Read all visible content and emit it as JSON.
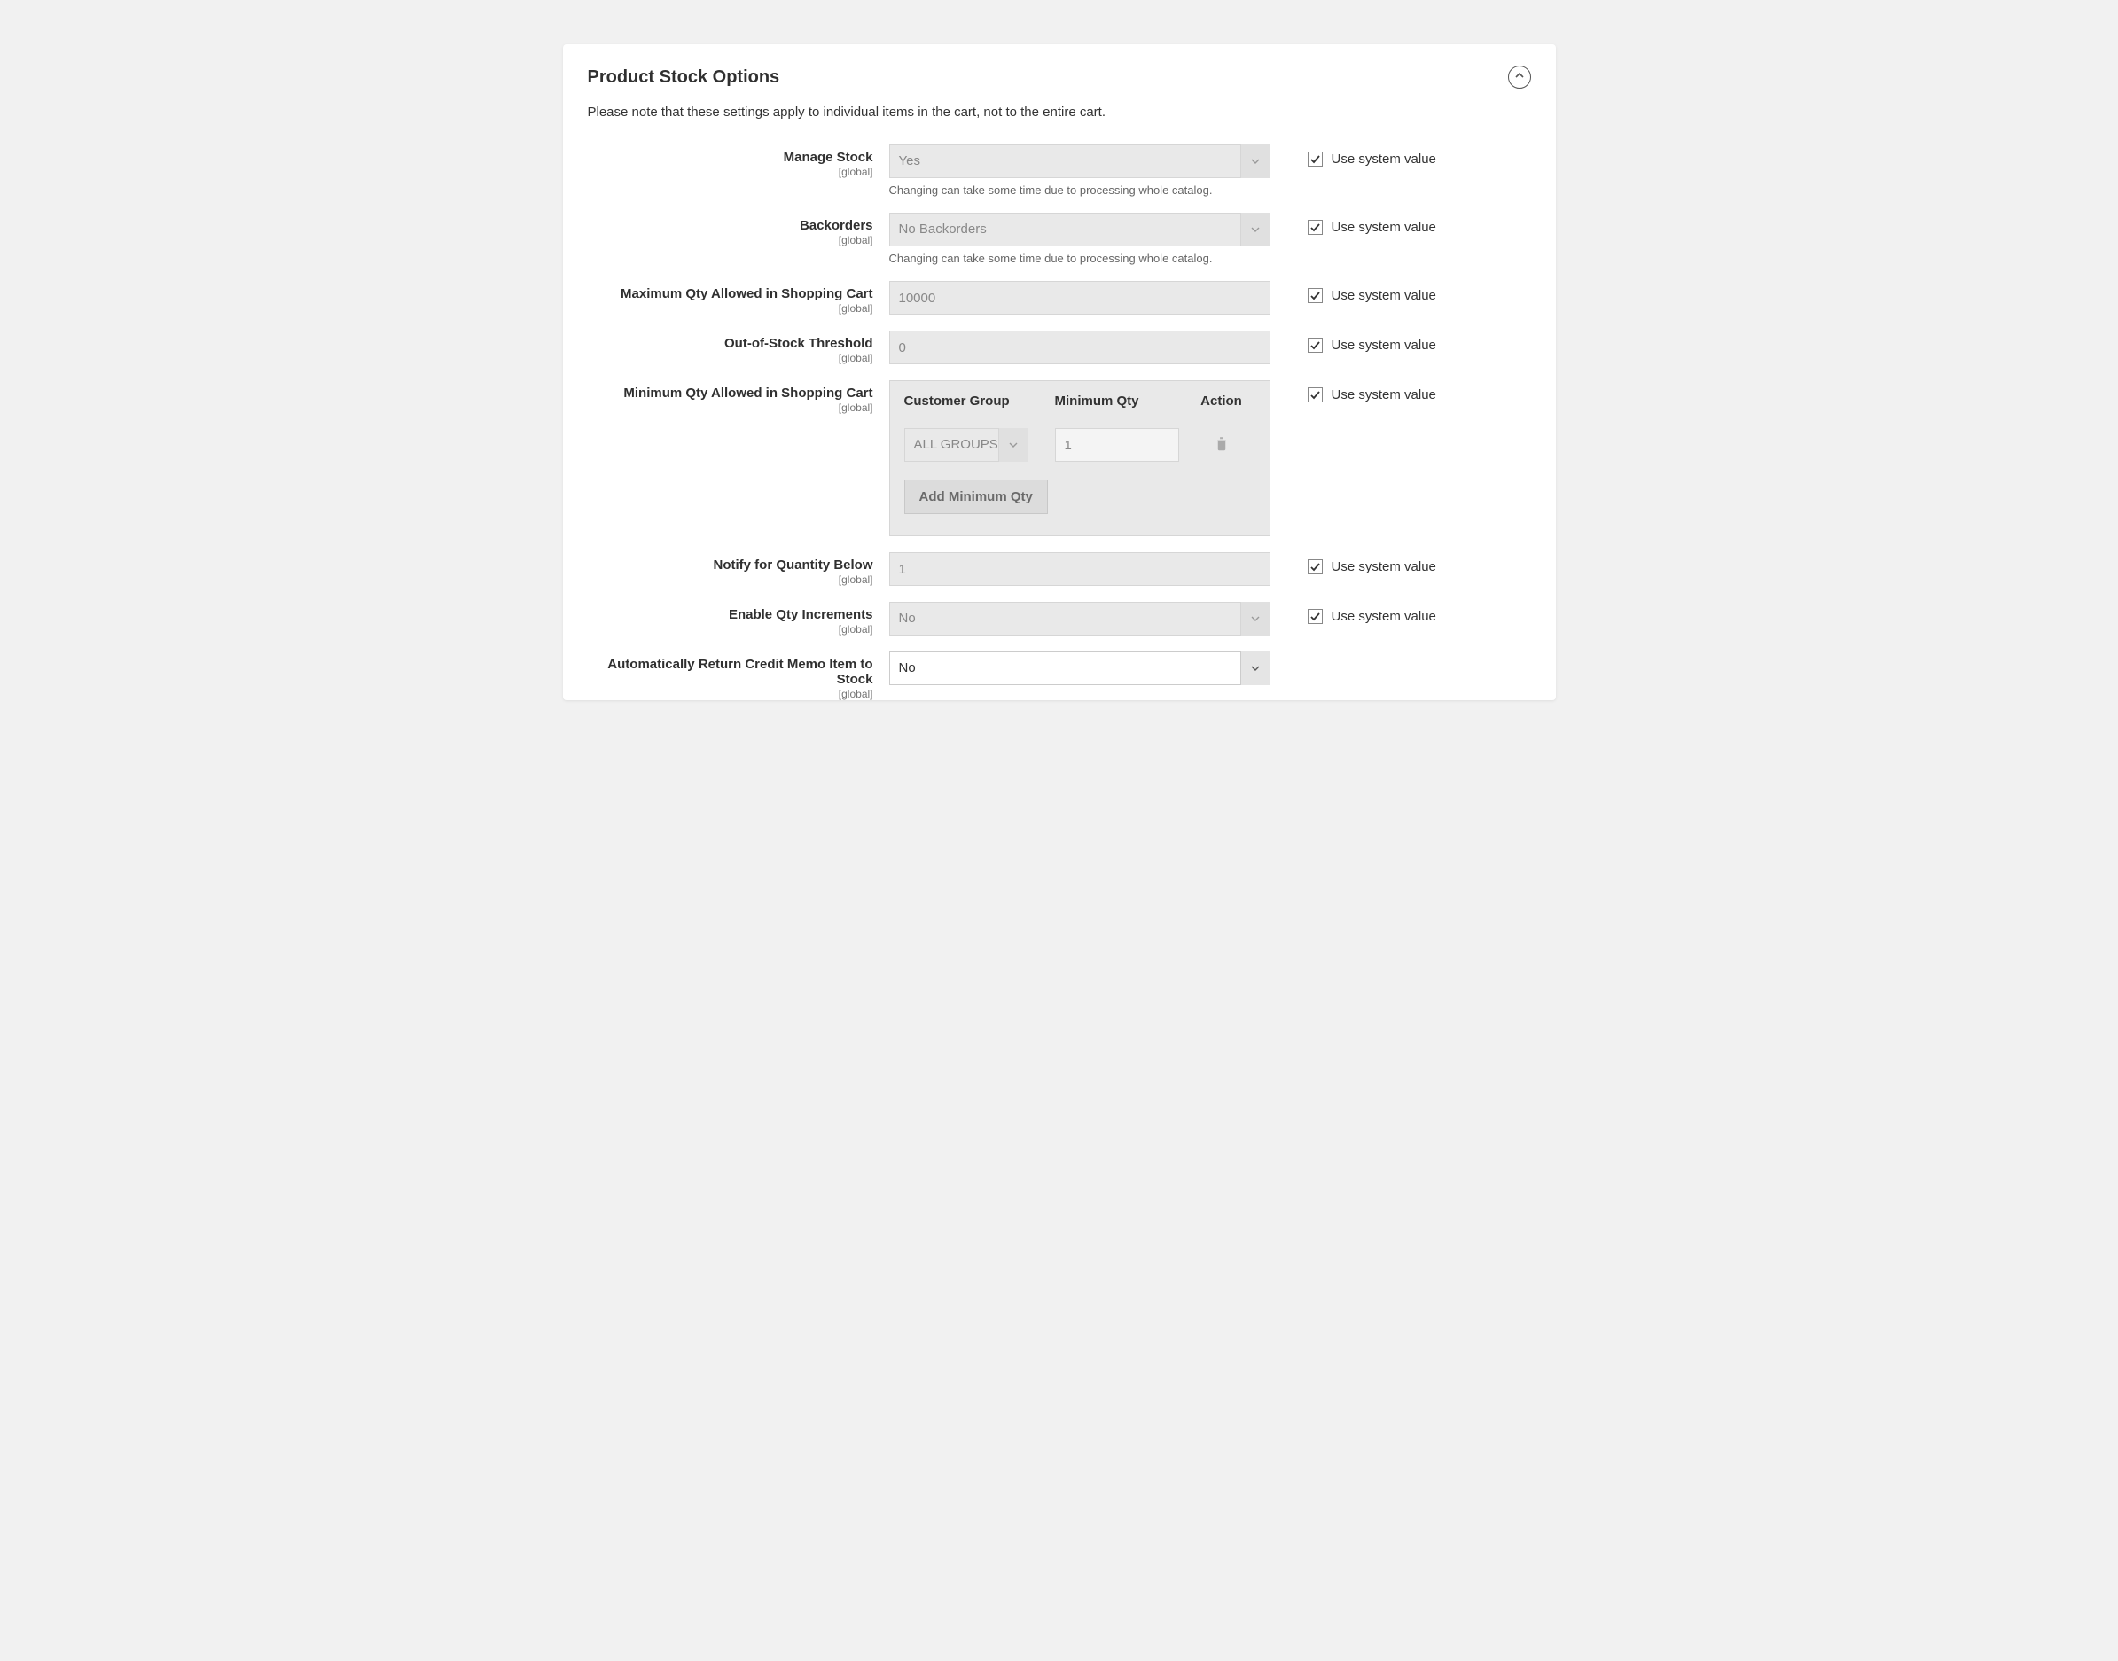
{
  "panel": {
    "title": "Product Stock Options",
    "note": "Please note that these settings apply to individual items in the cart, not to the entire cart."
  },
  "common": {
    "scope_global": "[global]",
    "use_system_value": "Use system value",
    "catalog_note": "Changing can take some time due to processing whole catalog."
  },
  "fields": {
    "manage_stock": {
      "label": "Manage Stock",
      "value": "Yes",
      "use_system": true
    },
    "backorders": {
      "label": "Backorders",
      "value": "No Backorders",
      "use_system": true
    },
    "max_qty": {
      "label": "Maximum Qty Allowed in Shopping Cart",
      "value": "10000",
      "use_system": true
    },
    "oos_threshold": {
      "label": "Out-of-Stock Threshold",
      "value": "0",
      "use_system": true
    },
    "min_qty": {
      "label": "Minimum Qty Allowed in Shopping Cart",
      "use_system": true,
      "columns": {
        "group": "Customer Group",
        "qty": "Minimum Qty",
        "action": "Action"
      },
      "rows": [
        {
          "group": "ALL GROUPS",
          "qty": "1"
        }
      ],
      "add_button": "Add Minimum Qty"
    },
    "notify_below": {
      "label": "Notify for Quantity Below",
      "value": "1",
      "use_system": true
    },
    "qty_increments": {
      "label": "Enable Qty Increments",
      "value": "No",
      "use_system": true
    },
    "auto_return": {
      "label": "Automatically Return Credit Memo Item to Stock",
      "value": "No",
      "use_system": false
    }
  }
}
